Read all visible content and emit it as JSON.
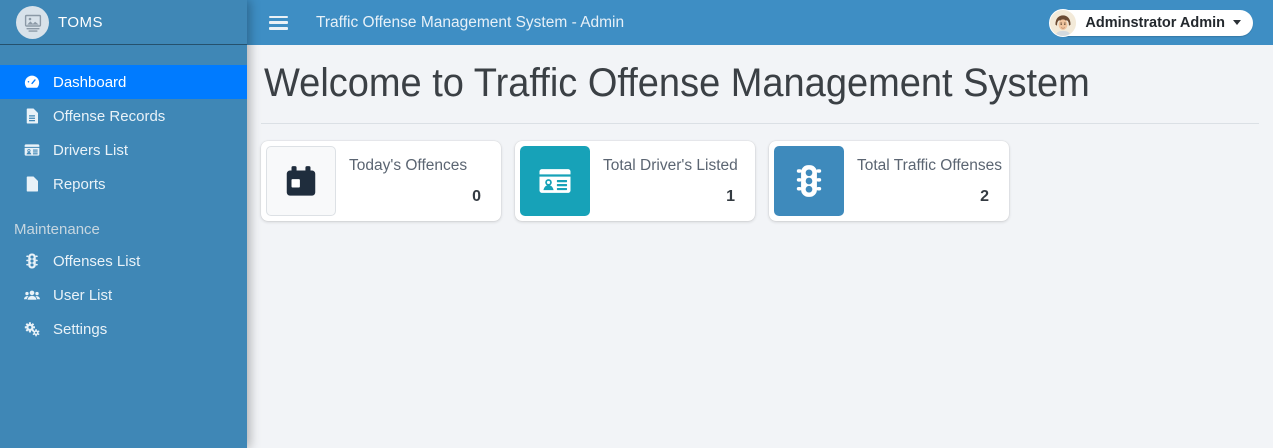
{
  "sidebar": {
    "brand": "TOMS",
    "items": [
      {
        "label": "Dashboard",
        "icon": "tachometer-icon",
        "active": true
      },
      {
        "label": "Offense Records",
        "icon": "file-alt-icon",
        "active": false
      },
      {
        "label": "Drivers List",
        "icon": "id-card-icon",
        "active": false
      },
      {
        "label": "Reports",
        "icon": "file-icon",
        "active": false
      }
    ],
    "section_header": "Maintenance",
    "section_items": [
      {
        "label": "Offenses List",
        "icon": "traffic-light-icon",
        "active": false
      },
      {
        "label": "User List",
        "icon": "users-icon",
        "active": false
      },
      {
        "label": "Settings",
        "icon": "cogs-icon",
        "active": false
      }
    ]
  },
  "topbar": {
    "title": "Traffic Offense Management System - Admin",
    "menu_icon": "hamburger-icon",
    "user_label": "Adminstrator Admin",
    "user_avatar_icon": "avatar-man-icon",
    "user_caret_icon": "caret-down-icon"
  },
  "main": {
    "heading": "Welcome to Traffic Offense Management System",
    "stat_cards": [
      {
        "title": "Today's Offences",
        "value": "0",
        "icon": "calendar-day-icon",
        "icon_bg": "#f8f9fa",
        "icon_color": "#1f2d3d"
      },
      {
        "title": "Total Driver's Listed",
        "value": "1",
        "icon": "id-card-icon",
        "icon_bg": "#17a2b8",
        "icon_color": "#ffffff"
      },
      {
        "title": "Total Traffic Offenses",
        "value": "2",
        "icon": "traffic-light-icon",
        "icon_bg": "#3e8abc",
        "icon_color": "#ffffff"
      }
    ]
  },
  "colors": {
    "sidebar_bg": "#3f87b6",
    "topbar_bg": "#3e8ec4",
    "active_nav_bg": "#007bff",
    "content_bg": "#f2f4f7",
    "card_icon_teal": "#17a2b8",
    "card_icon_blue": "#3e8abc",
    "card_icon_dark": "#1f2d3d"
  }
}
